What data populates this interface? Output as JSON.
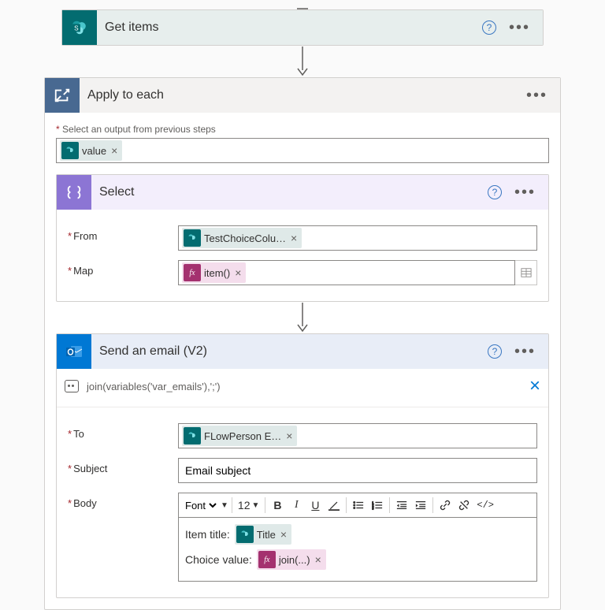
{
  "get_items": {
    "title": "Get items"
  },
  "apply": {
    "title": "Apply to each",
    "output_label": "Select an output from previous steps",
    "value_token": "value"
  },
  "select": {
    "title": "Select",
    "from_label": "From",
    "map_label": "Map",
    "from_token": "TestChoiceColu…",
    "map_token": "item()"
  },
  "email": {
    "title": "Send an email (V2)",
    "peek": "join(variables('var_emails'),';')",
    "to_label": "To",
    "to_token": "FLowPerson E…",
    "subject_label": "Subject",
    "subject_value": "Email subject",
    "body_label": "Body",
    "font_label": "Font",
    "size_label": "12",
    "body_line1_text": "Item title:",
    "body_line1_token": "Title",
    "body_line2_text": "Choice value:",
    "body_line2_token": "join(...)"
  },
  "icons": {
    "fx": "fx",
    "sp": "s"
  }
}
